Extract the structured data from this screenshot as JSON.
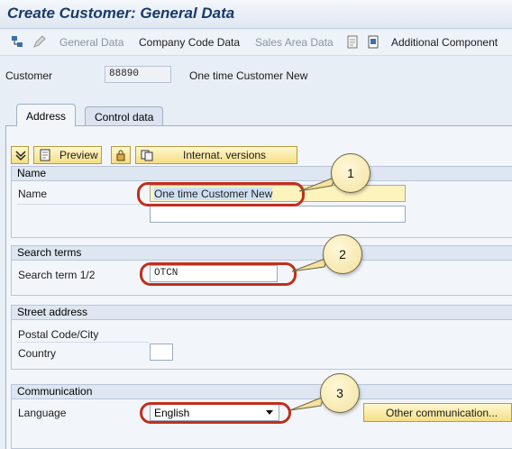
{
  "title": "Create Customer: General Data",
  "toolbar": {
    "general_data": "General Data",
    "company_code_data": "Company Code Data",
    "sales_area_data": "Sales Area Data",
    "additional_component": "Additional Component"
  },
  "customer": {
    "label": "Customer",
    "number": "88890",
    "description": "One time Customer New"
  },
  "tabs": {
    "address": "Address",
    "control_data": "Control data"
  },
  "buttons": {
    "preview": "Preview",
    "internat_versions": "Internat. versions"
  },
  "name_group": {
    "title": "Name",
    "name_label": "Name",
    "name_value": "One time Customer New"
  },
  "search_group": {
    "title": "Search terms",
    "label": "Search term 1/2",
    "value": "OTCN"
  },
  "street_group": {
    "title": "Street address",
    "postal_label": "Postal Code/City",
    "country_label": "Country"
  },
  "comm_group": {
    "title": "Communication",
    "language_label": "Language",
    "language_value": "English",
    "other_comm": "Other communication..."
  },
  "callouts": [
    "1",
    "2",
    "3"
  ],
  "colors": {
    "highlight": "#c02f1d",
    "button": "#f5df86",
    "title": "#173a68"
  }
}
